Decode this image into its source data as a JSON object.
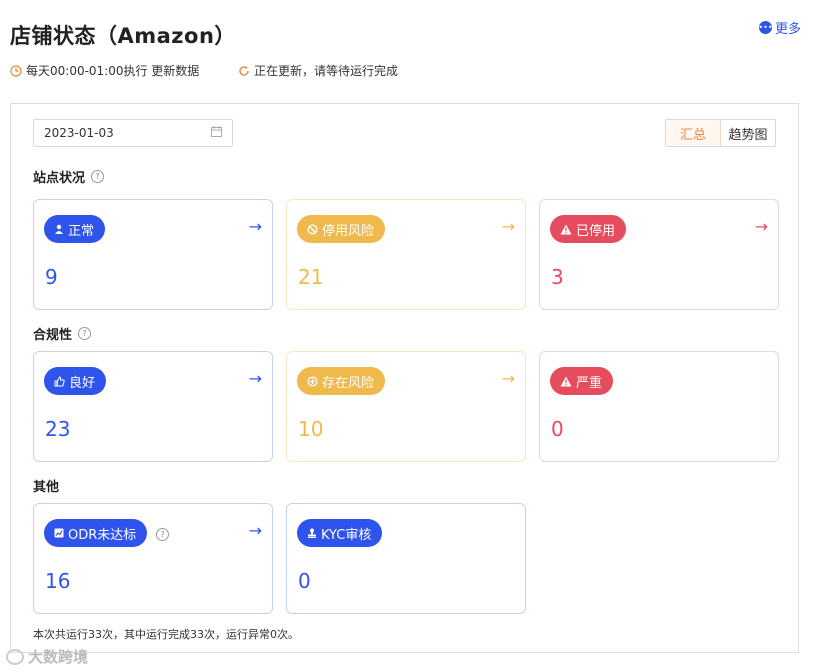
{
  "header": {
    "title": "店铺状态（Amazon）",
    "more_label": "更多",
    "more_icon": "more-dots-icon",
    "schedule_text": "每天00:00-01:00执行 更新数据",
    "schedule_icon": "clock-icon",
    "update_status": "正在更新，请等待运行完成",
    "update_icon": "refresh-icon"
  },
  "toolbar": {
    "date_value": "2023-01-03",
    "calendar_icon": "calendar-icon",
    "view_summary": "汇总",
    "view_trend": "趋势图",
    "active_view": "汇总"
  },
  "sections": {
    "site_status": {
      "title": "站点状况",
      "cards": [
        {
          "label": "正常",
          "value": "9",
          "icon": "user-icon",
          "color": "#2f54eb"
        },
        {
          "label": "停用风险",
          "value": "21",
          "icon": "ban-icon",
          "color": "#f0b94b"
        },
        {
          "label": "已停用",
          "value": "3",
          "icon": "warning-icon",
          "color": "#e54d5e"
        }
      ]
    },
    "compliance": {
      "title": "合规性",
      "cards": [
        {
          "label": "良好",
          "value": "23",
          "icon": "thumbs-up-icon",
          "color": "#2f54eb"
        },
        {
          "label": "存在风险",
          "value": "10",
          "icon": "plus-circle-icon",
          "color": "#f0b94b"
        },
        {
          "label": "严重",
          "value": "0",
          "icon": "warning-icon",
          "color": "#e54d5e"
        }
      ]
    },
    "other": {
      "title": "其他",
      "cards": [
        {
          "label": "ODR未达标",
          "value": "16",
          "icon": "chart-icon",
          "color": "#2f54eb"
        },
        {
          "label": "KYC审核",
          "value": "0",
          "icon": "stamp-icon",
          "color": "#2f54eb"
        }
      ]
    }
  },
  "footer": {
    "summary": "本次共运行33次，其中运行完成33次，运行异常0次。"
  },
  "watermark": {
    "text": "大数跨境"
  }
}
